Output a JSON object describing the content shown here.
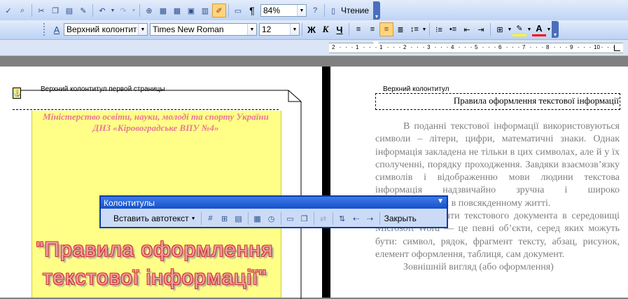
{
  "toolbar_standard": {
    "zoom": "84%",
    "reading_label": "Чтение"
  },
  "toolbar_formatting": {
    "style": "Верхний колонтит",
    "font": "Times New Roman",
    "size": "12",
    "bold": "Ж",
    "italic": "К",
    "underline": "Ч",
    "highlight_letter": "A"
  },
  "ruler": {
    "ticks": [
      "2",
      "1",
      "1",
      "2",
      "3",
      "4",
      "5",
      "6",
      "7",
      "8",
      "9",
      "10"
    ]
  },
  "left_page": {
    "header_label": "Верхний колонтитул первой страницы",
    "ministry_line1": "Міністерство освіти, науки, молоді та спорту України",
    "ministry_line2": "ДНЗ «Кіровоградське ВПУ №4»",
    "wordart_line1": "\"Правила оформлення",
    "wordart_line2": "текстової інформації\""
  },
  "right_page": {
    "header_label": "Верхний колонтитул",
    "header_text": "Правила оформлення текстової інформації",
    "paragraphs": [
      "В поданні текстової інформації використовуються символи – літери, цифри, математичні знаки. Однак інформація закладена не тільки в цих символах, але й у їх сполученні, порядку проходження. Завдяки взаємозв’язку символів і відображенню мови людини текстова інформація надзвичайно зручна і широко використовується в повсякденному житті.",
      "Усі елементи текстового документа в середовищі Microsoft Word — це певні об’єкти, серед яких можуть бути: символ, рядок, фрагмент тексту, абзац, рисунок, елемент оформлення, таблиця, сам документ.",
      "Зовнішній вигляд (або оформлення)"
    ]
  },
  "hf_toolbar": {
    "title": "Колонтитулы",
    "insert_autotext": "Вставить автотекст",
    "close": "Закрыть"
  },
  "colors": {
    "menu_blue": "#1650cb",
    "ministry_pink": "#e87896",
    "wordart_red": "#cc3333",
    "yellow_shape": "#ffff88"
  }
}
